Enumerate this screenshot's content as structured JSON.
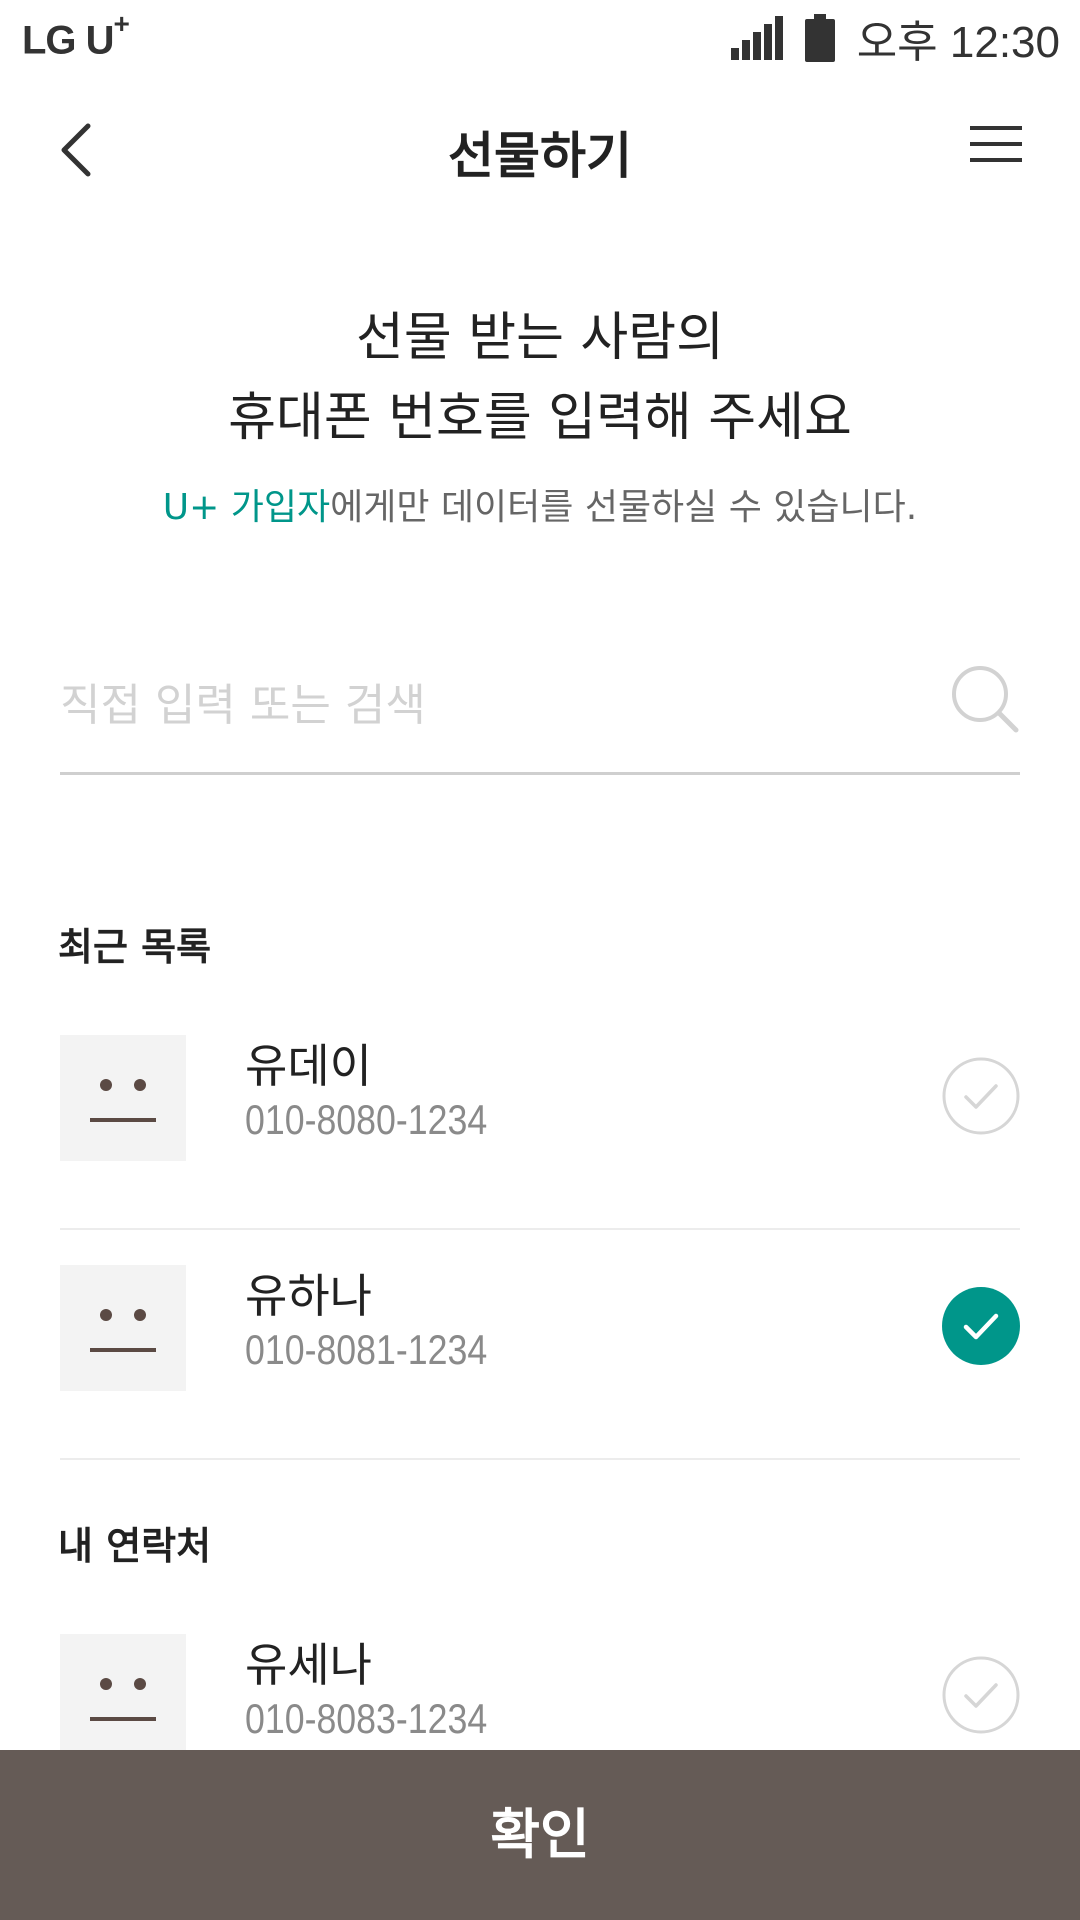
{
  "status_bar": {
    "carrier": "LG U",
    "carrier_plus": "+",
    "time": "오후 12:30",
    "signal_icon": "signal-icon",
    "battery_icon": "battery-icon"
  },
  "header": {
    "title": "선물하기",
    "back_icon": "chevron-left-icon",
    "menu_icon": "hamburger-icon"
  },
  "intro": {
    "line1": "선물 받는 사람의",
    "line2": "휴대폰 번호를 입력해 주세요",
    "sub_accent": "U+ 가입자",
    "sub_rest": "에게만 데이터를 선물하실 수 있습니다."
  },
  "search": {
    "placeholder": "직접 입력 또는 검색",
    "value": ""
  },
  "recent": {
    "title": "최근 목록",
    "items": [
      {
        "name": "유데이",
        "phone": "010-8080-1234",
        "selected": false
      },
      {
        "name": "유하나",
        "phone": "010-8081-1234",
        "selected": true
      }
    ]
  },
  "contacts": {
    "title": "내 연락처",
    "items": [
      {
        "name": "유세나",
        "phone": "010-8083-1234",
        "selected": false
      }
    ]
  },
  "footer": {
    "confirm_label": "확인"
  },
  "colors": {
    "accent": "#00968a",
    "footer_bg": "#655b56",
    "avatar_bg": "#f3f3f3",
    "avatar_face": "#5b4a44"
  }
}
